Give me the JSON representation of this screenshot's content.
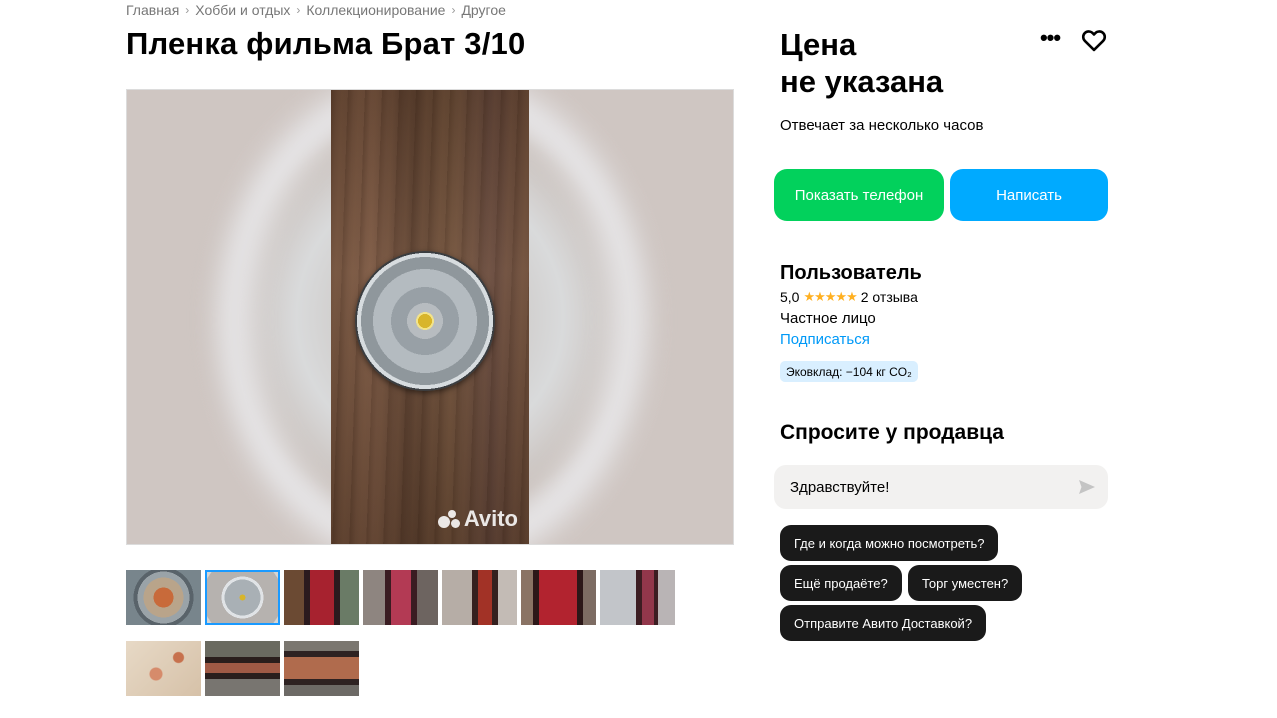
{
  "breadcrumb": [
    "Главная",
    "Хобби и отдых",
    "Коллекционирование",
    "Другое"
  ],
  "title": "Пленка фильма Брат 3/10",
  "photo": {
    "watermark": "Avito"
  },
  "thumbnails": [
    {
      "desc": "reel-top-view"
    },
    {
      "desc": "reel-on-wood",
      "active": true
    },
    {
      "desc": "film-strip-1"
    },
    {
      "desc": "film-strip-2"
    },
    {
      "desc": "film-strip-3"
    },
    {
      "desc": "film-strip-4"
    },
    {
      "desc": "film-strip-5"
    },
    {
      "desc": "film-close-up"
    },
    {
      "desc": "film-strip-6"
    },
    {
      "desc": "film-strip-7"
    }
  ],
  "price": {
    "line1": "Цена",
    "line2": "не указана"
  },
  "icons": {
    "more": "more-icon",
    "favorite": "heart-icon",
    "send": "send-icon"
  },
  "reply_time": "Отвечает за несколько часов",
  "buttons": {
    "phone": "Показать телефон",
    "write": "Написать"
  },
  "colors": {
    "phone": "#02d15c",
    "write": "#00aaff",
    "link": "#0099f7",
    "stars": "#ffb021"
  },
  "seller": {
    "name": "Пользователь",
    "rating": "5,0",
    "stars": "★★★★★",
    "reviews": "2 отзыва",
    "type": "Частное лицо",
    "subscribe": "Подписаться",
    "eco": "Эковклад: −104 кг CO₂"
  },
  "ask": {
    "title": "Спросите у продавца",
    "input_value": "Здравствуйте!",
    "chips": [
      "Где и когда можно посмотреть?",
      "Ещё продаёте?",
      "Торг уместен?",
      "Отправите Авито Доставкой?"
    ]
  }
}
